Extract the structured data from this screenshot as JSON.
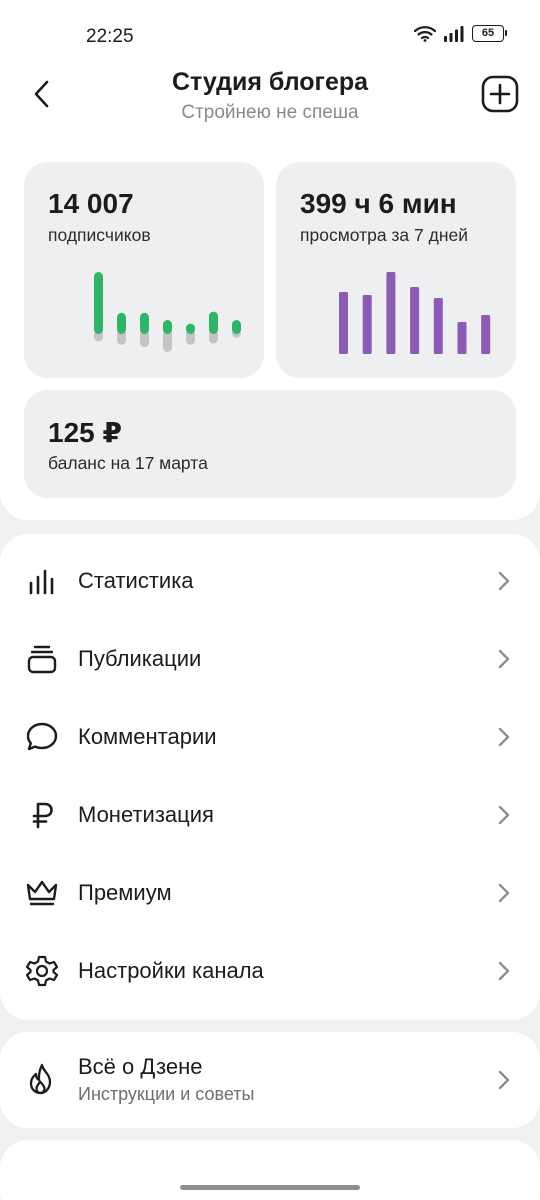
{
  "status": {
    "time": "22:25",
    "battery": "65"
  },
  "header": {
    "title": "Студия блогера",
    "subtitle": "Стройнею не спеша"
  },
  "stats": {
    "subscribers": {
      "value": "14 007",
      "label": "подписчиков",
      "chart_data": {
        "type": "bar",
        "series": [
          {
            "values": [
              1.0,
              0.32,
              0.32,
              0.2,
              0.14,
              0.34,
              0.2
            ],
            "color": "#2fb46a"
          },
          {
            "values": [
              -0.12,
              -0.18,
              -0.22,
              -0.3,
              -0.18,
              -0.16,
              -0.06
            ],
            "color": "#c4c4c6"
          }
        ]
      }
    },
    "views": {
      "value": "399 ч 6 мин",
      "label": "просмотра за 7 дней",
      "chart_data": {
        "type": "bar",
        "values": [
          62,
          59,
          82,
          67,
          56,
          32,
          39
        ],
        "color": "#8b5bb5"
      }
    },
    "balance": {
      "value": "125 ₽",
      "label": "баланс на 17 марта"
    }
  },
  "menu": [
    {
      "label": "Статистика",
      "icon": "bar-chart-icon"
    },
    {
      "label": "Публикации",
      "icon": "stack-icon"
    },
    {
      "label": "Комментарии",
      "icon": "comment-icon"
    },
    {
      "label": "Монетизация",
      "icon": "ruble-icon"
    },
    {
      "label": "Премиум",
      "icon": "crown-icon"
    },
    {
      "label": "Настройки канала",
      "icon": "gear-icon"
    }
  ],
  "zen": {
    "label": "Всё о Дзене",
    "sublabel": "Инструкции и советы",
    "icon": "flame-icon"
  }
}
